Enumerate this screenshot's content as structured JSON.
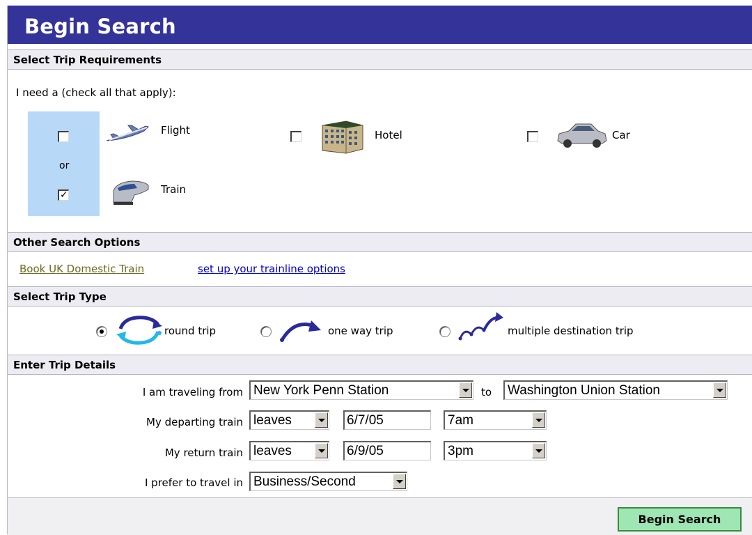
{
  "header": {
    "title": "Begin Search"
  },
  "requirements": {
    "section_label": "Select Trip Requirements",
    "prompt": "I need a (check all that apply):",
    "or_label": "or",
    "options": [
      {
        "label": "Flight",
        "checked": false,
        "icon": "airplane-icon"
      },
      {
        "label": "Hotel",
        "checked": false,
        "icon": "hotel-building-icon"
      },
      {
        "label": "Car",
        "checked": false,
        "icon": "car-icon"
      },
      {
        "label": "Train",
        "checked": true,
        "icon": "train-icon"
      }
    ]
  },
  "other_options": {
    "section_label": "Other Search Options",
    "link_uk": "Book UK Domestic Train",
    "link_trainline": "set up your trainline options"
  },
  "trip_type": {
    "section_label": "Select Trip Type",
    "options": [
      {
        "label": "round trip",
        "selected": true,
        "icon": "round-trip-arrows-icon"
      },
      {
        "label": "one way trip",
        "selected": false,
        "icon": "one-way-arc-icon"
      },
      {
        "label": "multiple destination trip",
        "selected": false,
        "icon": "multi-destination-arcs-icon"
      }
    ]
  },
  "details": {
    "section_label": "Enter Trip Details",
    "from_label": "I am traveling from",
    "from_value": "New York Penn Station",
    "to_label": "to",
    "to_value": "Washington Union Station",
    "depart_label": "My departing train",
    "depart_mode": "leaves",
    "depart_date": "6/7/05",
    "depart_time": "7am",
    "return_label": "My return train",
    "return_mode": "leaves",
    "return_date": "6/9/05",
    "return_time": "3pm",
    "class_label": "I prefer to travel in",
    "class_value": "Business/Second"
  },
  "actions": {
    "search_label": "Begin Search"
  },
  "colors": {
    "header_bg": "#333399",
    "section_bg": "#ececf2",
    "checkbox_band": "#b8d8f8",
    "search_button_bg": "#9ee6b4",
    "link_blue": "#0000cc",
    "link_olive": "#6b6b1f"
  }
}
